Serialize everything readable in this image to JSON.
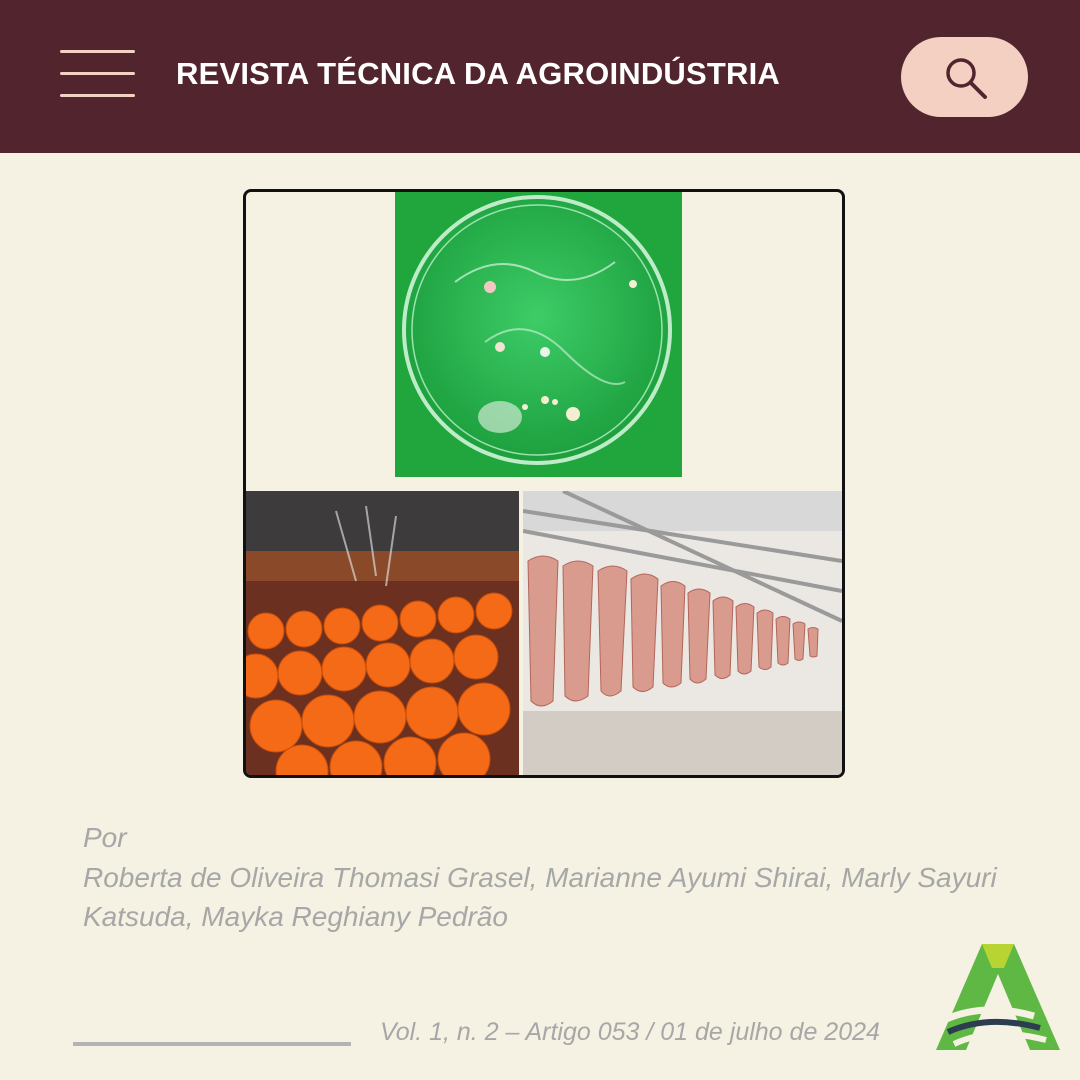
{
  "header": {
    "title": "REVISTA TÉCNICA DA AGROINDÚSTRIA",
    "menu_icon": "hamburger-menu-icon",
    "search_icon": "magnifier-icon"
  },
  "cover_images": [
    {
      "subject": "petri-dish"
    },
    {
      "subject": "oranges-on-conveyor"
    },
    {
      "subject": "meat-carcasses-processing-line"
    }
  ],
  "byline": {
    "label": "Por",
    "authors": "Roberta de Oliveira Thomasi Grasel, Marianne Ayumi Shirai, Marly Sayuri Katsuda, Mayka Reghiany Pedrão"
  },
  "footer": {
    "issue": "Vol. 1, n. 2 – Artigo 053 / 01 de julho de 2024"
  },
  "colors": {
    "header_bg": "#52252e",
    "page_bg": "#f5f1e3",
    "search_pill": "#f3d0c2",
    "logo_green": "#5fb844",
    "logo_lime": "#b8d432",
    "logo_navy": "#2b3d4f"
  }
}
